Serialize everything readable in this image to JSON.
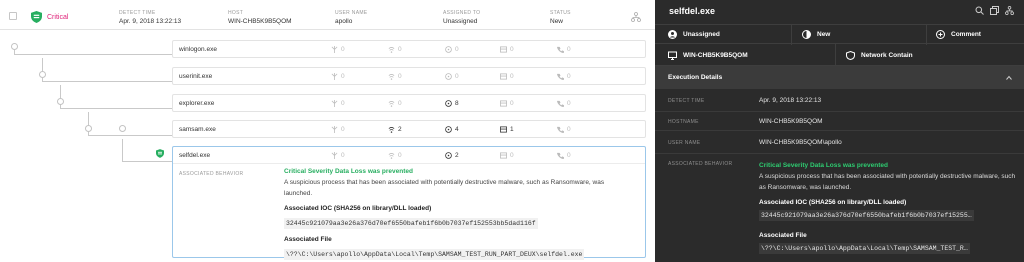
{
  "alert": {
    "severity": "Critical",
    "columns": [
      {
        "header": "DETECT TIME",
        "value": "Apr. 9, 2018 13:22:13"
      },
      {
        "header": "HOST",
        "value": "WIN-CHB5K9B5QOM"
      },
      {
        "header": "USER NAME",
        "value": "apollo"
      },
      {
        "header": "ASSIGNED TO",
        "value": "Unassigned"
      },
      {
        "header": "STATUS",
        "value": "New"
      }
    ]
  },
  "processes": [
    {
      "name": "winlogon.exe",
      "m1": "0",
      "m2": "0",
      "m3": "0",
      "m4": "0",
      "m5": "0"
    },
    {
      "name": "userinit.exe",
      "m1": "0",
      "m2": "0",
      "m3": "0",
      "m4": "0",
      "m5": "0"
    },
    {
      "name": "explorer.exe",
      "m1": "0",
      "m2": "0",
      "m3": "8",
      "m4": "0",
      "m5": "0"
    },
    {
      "name": "samsam.exe",
      "m1": "0",
      "m2": "2",
      "m3": "4",
      "m4": "1",
      "m5": "0"
    },
    {
      "name": "selfdel.exe",
      "m1": "0",
      "m2": "0",
      "m3": "2",
      "m4": "0",
      "m5": "0"
    }
  ],
  "detail": {
    "label": "ASSOCIATED BEHAVIOR",
    "title": "Critical Severity Data Loss was prevented",
    "description": "A suspicious process that has been associated with potentially destructive malware, such as Ransomware, was launched.",
    "ioc_header": "Associated IOC (SHA256 on library/DLL loaded)",
    "ioc": "32445c921079aa3e26a376d70ef6550bafeb1f6b0b7037ef152553bb5dad116f",
    "file_header": "Associated File",
    "file": "\\??\\C:\\Users\\apollo\\AppData\\Local\\Temp\\SAMSAM_TEST_RUN_PART_DEUX\\selfdel.exe"
  },
  "panel": {
    "title": "selfdel.exe",
    "actions": {
      "assign": "Unassigned",
      "status": "New",
      "comment": "Comment",
      "host": "WIN-CHB5K9B5QOM",
      "contain": "Network Contain"
    },
    "section": "Execution Details",
    "rows": [
      {
        "key": "DETECT TIME",
        "value": "Apr. 9, 2018 13:22:13"
      },
      {
        "key": "HOSTNAME",
        "value": "WIN-CHB5K9B5QOM"
      },
      {
        "key": "USER NAME",
        "value": "WIN-CHB5K9B5QOM\\apollo"
      },
      {
        "key": "ASSOCIATED BEHAVIOR",
        "value": ""
      }
    ],
    "behavior_title": "Critical Severity Data Loss was prevented",
    "behavior_desc": "A suspicious process that has been associated with potentially destructive malware, such as Ransomware, was launched.",
    "ioc_header": "Associated IOC (SHA256 on library/DLL loaded)",
    "ioc": "32445c921079aa3e26a376d70ef6550bafeb1f6b0b7037ef15255…",
    "file_header": "Associated File",
    "file": "\\??\\C:\\Users\\apollo\\AppData\\Local\\Temp\\SAMSAM_TEST_R…"
  },
  "colors": {
    "critical": "#e0237a",
    "green": "#27ae60",
    "panel_bg": "#2b2b2b",
    "selected_border": "#9bc7ea"
  }
}
